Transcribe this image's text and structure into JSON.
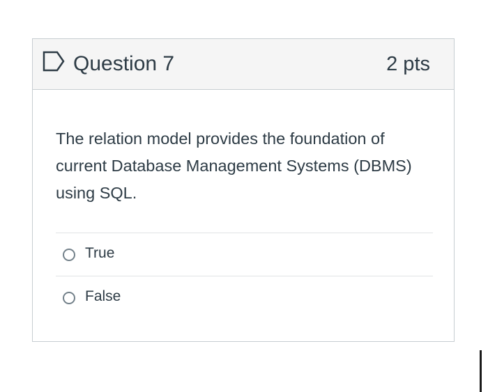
{
  "question": {
    "title": "Question 7",
    "points": "2 pts",
    "flag_icon": "flag-question-icon",
    "text": "The relation model provides the foundation of current Database Management Systems (DBMS) using SQL.",
    "answers": [
      {
        "label": "True",
        "selected": false
      },
      {
        "label": "False",
        "selected": false
      }
    ]
  },
  "colors": {
    "header_background": "#f5f5f5",
    "border": "#c7cdd1",
    "text": "#2d3b45",
    "divider": "#e0e3e5",
    "radio_border": "#73818a"
  }
}
